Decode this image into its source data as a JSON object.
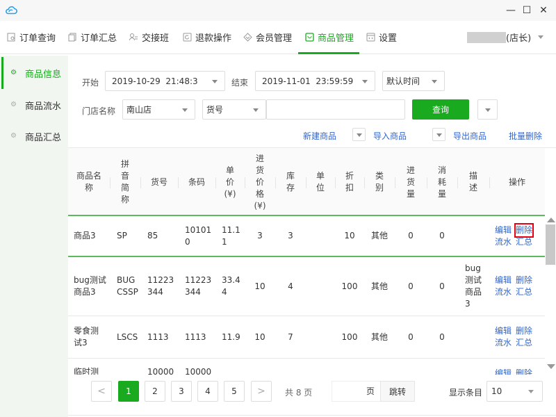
{
  "window": {
    "logo_icon": "cloud-icon",
    "controls": {
      "minimize": "—",
      "maximize": "☐",
      "close": "✕"
    }
  },
  "nav": {
    "tabs": [
      {
        "label": "订单查询",
        "icon": "order-search-icon",
        "active": false
      },
      {
        "label": "订单汇总",
        "icon": "order-summary-icon",
        "active": false
      },
      {
        "label": "交接班",
        "icon": "handover-icon",
        "active": false
      },
      {
        "label": "退款操作",
        "icon": "refund-icon",
        "active": false
      },
      {
        "label": "会员管理",
        "icon": "member-icon",
        "active": false
      },
      {
        "label": "商品管理",
        "icon": "goods-icon",
        "active": true
      },
      {
        "label": "设置",
        "icon": "settings-icon",
        "active": false
      }
    ],
    "user_role": "(店长)"
  },
  "sidebar": {
    "items": [
      {
        "label": "商品信息",
        "active": true
      },
      {
        "label": "商品流水",
        "active": false
      },
      {
        "label": "商品汇总",
        "active": false
      }
    ]
  },
  "filters": {
    "start_label": "开始",
    "start_value": "2019-10-29  21:48:3",
    "end_label": "结束",
    "end_value": "2019-11-01  23:59:59",
    "time_mode": "默认时间",
    "store_label": "门店名称",
    "store_value": "南山店",
    "field_select": "货号",
    "keyword_value": "",
    "query_button": "查询"
  },
  "actions": {
    "new_goods": "新建商品",
    "import_goods": "导入商品",
    "export_goods": "导出商品",
    "batch_delete": "批量删除"
  },
  "table": {
    "columns": [
      "商品名称",
      "拼音简称",
      "货号",
      "条码",
      "单价(¥)",
      "进货价格(¥)",
      "库存",
      "单位",
      "折扣",
      "类别",
      "进货量",
      "消耗量",
      "描述",
      "操作"
    ],
    "header_lines": [
      [
        "商品名",
        "称"
      ],
      [
        "拼",
        "音",
        "简",
        "称"
      ],
      [
        "货号"
      ],
      [
        "条码"
      ],
      [
        "单",
        "价",
        "(¥)"
      ],
      [
        "进",
        "货",
        "价",
        "格",
        "(¥)"
      ],
      [
        "库",
        "存"
      ],
      [
        "单",
        "位"
      ],
      [
        "折",
        "扣"
      ],
      [
        "类",
        "别"
      ],
      [
        "进",
        "货",
        "量"
      ],
      [
        "消",
        "耗",
        "量"
      ],
      [
        "描",
        "述"
      ],
      [
        "操作"
      ]
    ],
    "row_actions": [
      "编辑",
      "删除",
      "流水",
      "汇总"
    ],
    "rows": [
      {
        "name": [
          "商品3"
        ],
        "pinyin": [
          "SP"
        ],
        "sku": [
          "85"
        ],
        "barcode": [
          "10101",
          "0"
        ],
        "price": [
          "11.1",
          "1"
        ],
        "cost": "3",
        "stock": "3",
        "unit": "",
        "discount": "10",
        "category": "其他",
        "purchased": "0",
        "consumed": "0",
        "desc": []
      },
      {
        "name": [
          "bug测试",
          "商品3"
        ],
        "pinyin": [
          "BUG",
          "CSSP"
        ],
        "sku": [
          "11223",
          "344"
        ],
        "barcode": [
          "11223",
          "344"
        ],
        "price": [
          "33.4",
          "4"
        ],
        "cost": "10",
        "stock": "4",
        "unit": "",
        "discount": "100",
        "category": "其他",
        "purchased": "0",
        "consumed": "0",
        "desc": [
          "bug",
          "测试",
          "商品",
          "3"
        ]
      },
      {
        "name": [
          "零食测",
          "试3"
        ],
        "pinyin": [
          "LSCS"
        ],
        "sku": [
          "1113"
        ],
        "barcode": [
          "1113"
        ],
        "price": [
          "11.9"
        ],
        "cost": "10",
        "stock": "7",
        "unit": "",
        "discount": "100",
        "category": "其他",
        "purchased": "0",
        "consumed": "0",
        "desc": []
      },
      {
        "name": [
          "临时测"
        ],
        "pinyin": [],
        "sku": [
          "10000"
        ],
        "barcode": [
          "10000"
        ],
        "price": [],
        "cost": "",
        "stock": "",
        "unit": "",
        "discount": "",
        "category": "",
        "purchased": "",
        "consumed": "",
        "desc": []
      }
    ]
  },
  "pagination": {
    "prev": "<",
    "next": ">",
    "pages": [
      "1",
      "2",
      "3",
      "4",
      "5"
    ],
    "current": "1",
    "total_text": "共 8 页",
    "jump_value": "",
    "jump_suffix": "页",
    "jump_button": "跳转",
    "page_size_label": "显示条目",
    "page_size": "10"
  },
  "colors": {
    "accent": "#1aaa1f",
    "link": "#3366cc",
    "highlight_box": "#e60012"
  }
}
